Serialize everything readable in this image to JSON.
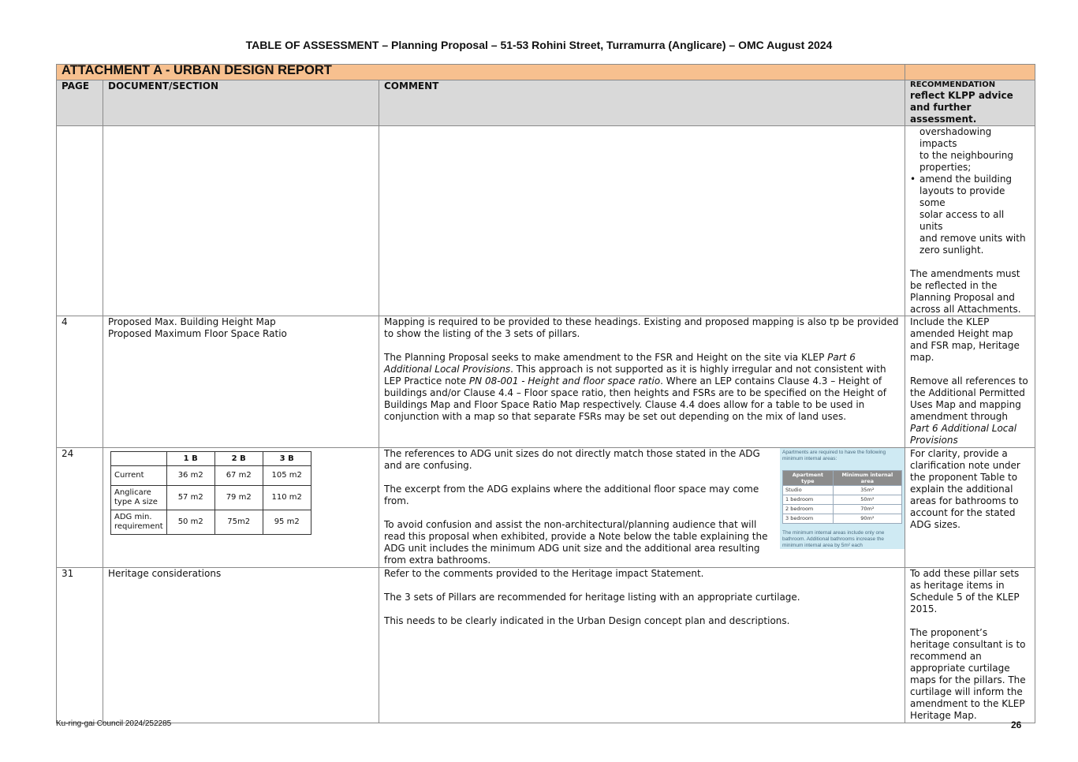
{
  "doc_title": "TABLE OF ASSESSMENT – Planning Proposal – 51-53 Rohini Street, Turramurra (Anglicare) – OMC August 2024",
  "banner": "ATTACHMENT A - URBAN DESIGN REPORT",
  "headers": {
    "page": "PAGE",
    "section": "DOCUMENT/SECTION",
    "comment": "COMMENT",
    "rec_small": "RECOMMENDATION",
    "rec_big": "reflect KLPP advice and further assessment."
  },
  "row1": {
    "rec_cont": [
      "overshadowing impacts",
      "to the neighbouring",
      "properties;"
    ],
    "rec_bullet": [
      "amend the building",
      "layouts to provide some",
      "solar access to all units",
      "and remove units with",
      "zero sunlight."
    ],
    "rec_para": "The amendments must be reflected in the Planning Proposal and across all Attachments."
  },
  "row2": {
    "page": "4",
    "section1": "Proposed Max. Building Height Map",
    "section2": "Proposed Maximum Floor Space Ratio",
    "comment1": "Mapping is required to be provided to these headings. Existing and proposed mapping is also tp be provided to show the listing of the 3 sets of pillars.",
    "comment2a": "The Planning Proposal seeks to make amendment to the FSR and Height on the site via KLEP ",
    "comment2b": "Part 6 Additional Local Provisions",
    "comment2c": ". This approach is not supported as it is highly irregular and not consistent with LEP Practice note ",
    "comment2d": "PN 08-001 - Height and floor space ratio",
    "comment2e": ". Where an LEP contains Clause 4.3 – Height of buildings and/or Clause 4.4 – Floor space ratio, then heights and FSRs are to be specified on the Height of Buildings Map and Floor Space Ratio Map respectively. Clause 4.4 does allow for a table to be used in conjunction with a map so that separate FSRs may be set out depending on the mix of land uses.",
    "rec1": "Include the KLEP amended Height map and FSR map, Heritage map.",
    "rec2a": "Remove all references to the Additional Permitted Uses Map and mapping amendment through ",
    "rec2b": "Part 6 Additional Local Provisions"
  },
  "row3": {
    "page": "24",
    "unit_table": {
      "cols": [
        "1 B",
        "2 B",
        "3 B"
      ],
      "rows": [
        {
          "label": "Current",
          "v": [
            "36 m2",
            "67 m2",
            "105 m2"
          ]
        },
        {
          "label": "Anglicare type A size",
          "v": [
            "57 m2",
            "79 m2",
            "110 m2"
          ]
        },
        {
          "label": "ADG min. requirement",
          "v": [
            "50 m2",
            "75m2",
            "95 m2"
          ]
        }
      ]
    },
    "comment1": "The references to ADG unit sizes do not directly match those stated in the ADG and are confusing.",
    "comment2": "The excerpt from the ADG explains where the additional floor space may come from.",
    "comment3": "To avoid confusion and assist the non-architectural/planning audience that will read this proposal when exhibited, provide a Note below the table explaining the ADG unit includes the minimum ADG unit size and the additional area resulting from extra bathrooms.",
    "adg_excerpt": {
      "intro": "Apartments are required to have the following minimum internal areas:",
      "head": [
        "Apartment type",
        "Minimum internal area"
      ],
      "rows": [
        [
          "Studio",
          "35m²"
        ],
        [
          "1 bedroom",
          "50m²"
        ],
        [
          "2 bedroom",
          "70m²"
        ],
        [
          "3 bedroom",
          "90m²"
        ]
      ],
      "note": "The minimum internal areas include only one bathroom. Additional bathrooms increase the minimum internal area by 5m² each"
    },
    "rec": "For clarity, provide a clarification note under the proponent Table to explain the additional areas for bathrooms to account for the stated ADG sizes."
  },
  "row4": {
    "page": "31",
    "section": "Heritage considerations",
    "comment1": "Refer to the comments provided to the Heritage impact Statement.",
    "comment2": "The 3 sets of Pillars are recommended for heritage listing with an appropriate curtilage.",
    "comment3": "This needs to be clearly indicated in the Urban Design concept plan and descriptions.",
    "rec1": "To add these pillar sets as heritage items in Schedule 5 of the KLEP 2015.",
    "rec2": "The proponent’s heritage consultant is to recommend an appropriate curtilage maps for the pillars. The curtilage will inform the amendment to the KLEP Heritage Map."
  },
  "footer": {
    "left": "Ku-ring-gai Council 2024/252285",
    "page_number": "26"
  }
}
